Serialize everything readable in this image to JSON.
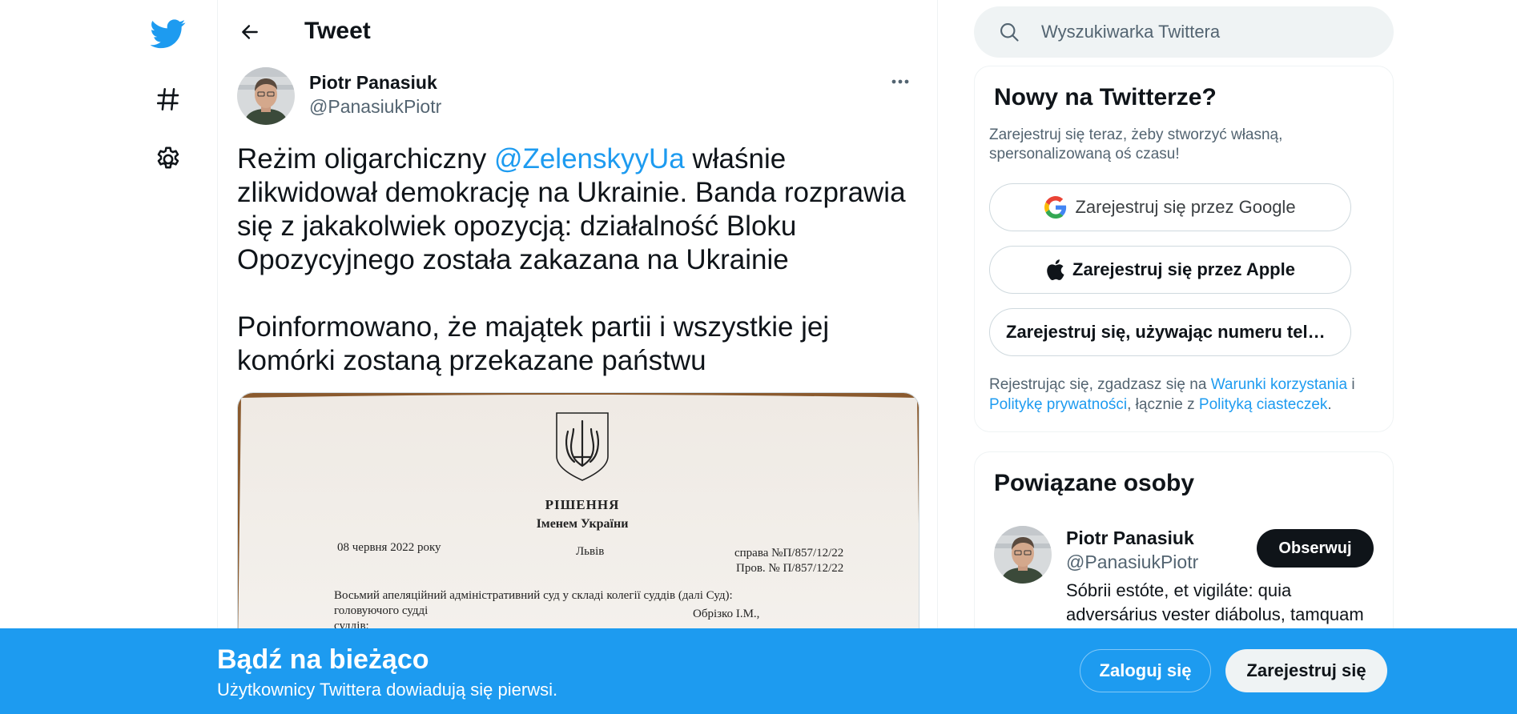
{
  "nav": {
    "icons": [
      "twitter-bird-icon",
      "hashtag-icon",
      "gear-icon"
    ],
    "brand_color": "#1d9bf0"
  },
  "header": {
    "title": "Tweet"
  },
  "tweet": {
    "author_name": "Piotr Panasiuk",
    "author_handle": "@PanasiukPiotr",
    "text_p1_before": "Reżim oligarchiczny ",
    "mention": "@ZelenskyyUa",
    "text_p1_after": " właśnie zlikwidował demokrację na Ukrainie. Banda rozprawia się z jakakolwiek opozycją: działalność Bloku Opozycyjnego została zakazana na Ukrainie",
    "text_p2": "Poinformowano, że majątek partii i wszystkie jej komórki zostaną przekazane państwu",
    "media": {
      "doc_title": "РІШЕННЯ",
      "doc_subtitle": "Іменем України",
      "doc_date": "08 червня 2022 року",
      "doc_city": "Львів",
      "doc_case1": "справа №П/857/12/22",
      "doc_case2": "Пров. № П/857/12/22",
      "doc_body1": "Восьмий апеляційний адміністративний суд у складі колегії суддів (далі Суд):",
      "doc_body2": "головуючого судді",
      "doc_body3": "Обрізко І.М.,",
      "doc_body4": "суддів:"
    }
  },
  "search": {
    "placeholder": "Wyszukiwarka Twittera"
  },
  "signup_card": {
    "title": "Nowy na Twitterze?",
    "subtitle": "Zarejestruj się teraz, żeby stworzyć własną, spersonalizowaną oś czasu!",
    "google_label": "Zarejestruj się przez Google",
    "apple_label": "Zarejestruj się przez Apple",
    "phone_label": "Zarejestruj się, używając numeru telefonu",
    "terms_1": "Rejestrując się, zgadzasz się na ",
    "terms_link1": "Warunki korzystania",
    "terms_2": " i ",
    "terms_link2": "Politykę prywatności",
    "terms_3": ", łącznie z ",
    "terms_link3": "Polityką ciasteczek",
    "terms_4": "."
  },
  "related_card": {
    "title": "Powiązane osoby",
    "name": "Piotr Panasiuk",
    "handle": "@PanasiukPiotr",
    "follow_label": "Obserwuj",
    "bio": "Sóbrii estóte, et vigiláte: quia adversárius vester diábolus, tamquam"
  },
  "banner": {
    "title": "Bądź na bieżąco",
    "subtitle": "Użytkownicy Twittera dowiadują się pierwsi.",
    "login_label": "Zaloguj się",
    "register_label": "Zarejestruj się",
    "background_color": "#1d9bf0"
  }
}
